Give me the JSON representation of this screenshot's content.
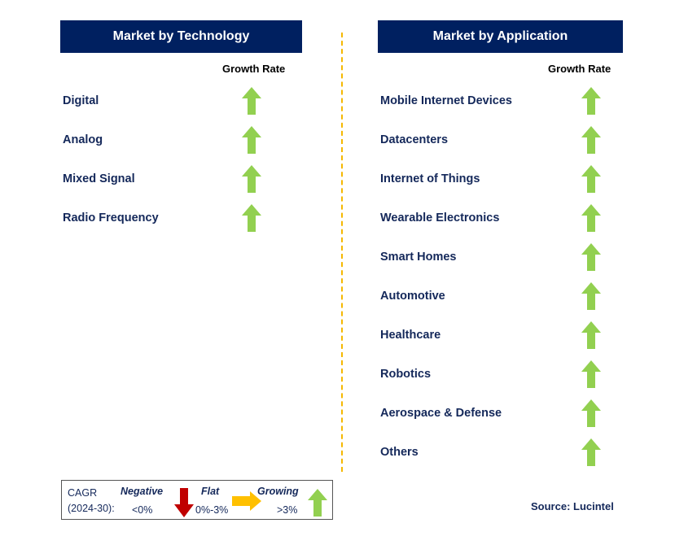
{
  "technology": {
    "title": "Market by Technology",
    "growth_label": "Growth Rate",
    "items": [
      {
        "label": "Digital",
        "trend": "growing"
      },
      {
        "label": "Analog",
        "trend": "growing"
      },
      {
        "label": "Mixed Signal",
        "trend": "growing"
      },
      {
        "label": "Radio Frequency",
        "trend": "growing"
      }
    ]
  },
  "application": {
    "title": "Market by Application",
    "growth_label": "Growth Rate",
    "items": [
      {
        "label": "Mobile Internet Devices",
        "trend": "growing"
      },
      {
        "label": "Datacenters",
        "trend": "growing"
      },
      {
        "label": "Internet of Things",
        "trend": "growing"
      },
      {
        "label": "Wearable Electronics",
        "trend": "growing"
      },
      {
        "label": "Smart Homes",
        "trend": "growing"
      },
      {
        "label": "Automotive",
        "trend": "growing"
      },
      {
        "label": "Healthcare",
        "trend": "growing"
      },
      {
        "label": "Robotics",
        "trend": "growing"
      },
      {
        "label": "Aerospace & Defense",
        "trend": "growing"
      },
      {
        "label": "Others",
        "trend": "growing"
      }
    ]
  },
  "legend": {
    "cagr": "CAGR",
    "period": "(2024-30):",
    "negative": "Negative",
    "negative_range": "<0%",
    "flat": "Flat",
    "flat_range": "0%-3%",
    "growing": "Growing",
    "growing_range": ">3%"
  },
  "source": "Source: Lucintel",
  "colors": {
    "header": "#002060",
    "growing": "#92d050",
    "flat": "#ffc000",
    "negative": "#c00000",
    "divider": "#f5b800"
  }
}
